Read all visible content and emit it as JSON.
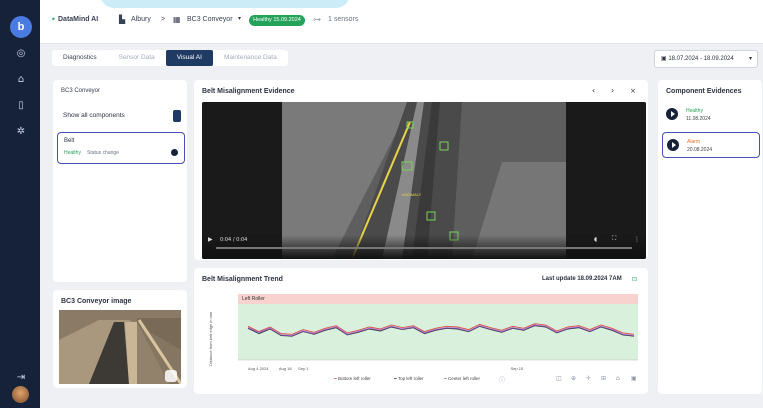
{
  "brand": {
    "name": "DataMind AI",
    "logo_letter": "b"
  },
  "breadcrumb": {
    "site": "Albury",
    "separator": ">",
    "asset": "BC3 Conveyor",
    "status": "Healthy 15.09.2024",
    "sensors": "1 sensors"
  },
  "tabs": [
    {
      "label": "Diagnostics"
    },
    {
      "label": "Sensor Data"
    },
    {
      "label": "Visual AI"
    },
    {
      "label": "Maintenance Data"
    }
  ],
  "date_range": "18.07.2024 - 18.09.2024",
  "components_panel": {
    "title": "BC3 Conveyor",
    "show_all": "Show all components",
    "belt": {
      "name": "Belt",
      "status": "Healthy",
      "note": "Status change"
    }
  },
  "image_panel": {
    "title": "BC3 Conveyor image"
  },
  "video_panel": {
    "title": "Belt Misalignment Evidence",
    "time": "0:04 / 0:04",
    "overlay_label": "ANOMALY"
  },
  "trend_panel": {
    "title": "Belt Misalignment Trend",
    "last_update": "Last update 18.09.2024 7AM",
    "legend": [
      "Bottom left roller",
      "Top left roller",
      "Center left roller"
    ]
  },
  "evidences_panel": {
    "title": "Component Evidences",
    "items": [
      {
        "label": "Healthy",
        "date": "11.08.2024",
        "color": "#25a35a"
      },
      {
        "label": "Alarm",
        "date": "20.08.2024",
        "color": "#e8722a"
      }
    ]
  },
  "colors": {
    "sidebar": "#16213a",
    "accent": "#1f3a63",
    "healthy": "#25a35a",
    "alarm": "#e8722a",
    "series_bottom": "#d94b4b",
    "series_top": "#2b3140",
    "series_center": "#a05fc7"
  },
  "chart_data": {
    "type": "line",
    "title": "Belt Misalignment Trend",
    "subtitle": "Left Roller",
    "xlabel": "",
    "ylabel": "Distance from belt edge in mm",
    "x_ticks": [
      "Aug 4 2024",
      "Aug 18",
      "Sep 1",
      "Sep 15"
    ],
    "ylim": [
      0,
      10
    ],
    "series": [
      {
        "name": "Bottom left roller",
        "values": [
          5.1,
          4.3,
          5.0,
          4.0,
          3.9,
          4.6,
          4.2,
          4.8,
          5.2,
          4.1,
          4.5,
          5.0,
          4.7,
          5.3,
          4.9,
          5.2,
          4.3,
          4.8,
          5.1,
          5.0,
          4.6,
          5.4,
          4.9,
          4.5,
          5.1,
          4.8,
          5.5,
          5.3,
          4.4,
          5.0,
          5.2,
          4.6,
          5.3,
          4.8,
          4.1,
          3.9
        ]
      },
      {
        "name": "Top left roller",
        "values": [
          4.8,
          4.0,
          4.7,
          3.7,
          3.6,
          4.3,
          3.9,
          4.5,
          4.9,
          3.8,
          4.2,
          4.7,
          4.4,
          5.0,
          4.6,
          4.9,
          4.0,
          4.5,
          4.8,
          4.7,
          4.3,
          5.1,
          4.6,
          4.2,
          4.8,
          4.5,
          5.2,
          5.0,
          4.1,
          4.7,
          4.9,
          4.3,
          5.0,
          4.5,
          3.8,
          3.6
        ]
      },
      {
        "name": "Center left roller",
        "values": [
          4.9,
          4.2,
          4.8,
          3.8,
          3.7,
          4.4,
          4.0,
          4.6,
          5.0,
          3.9,
          4.3,
          4.8,
          4.5,
          5.1,
          4.7,
          5.0,
          4.1,
          4.6,
          4.9,
          4.8,
          4.4,
          5.2,
          4.7,
          4.3,
          4.9,
          4.6,
          5.3,
          5.1,
          4.2,
          4.8,
          5.0,
          4.4,
          5.1,
          4.6,
          3.9,
          3.7
        ]
      }
    ],
    "bands": {
      "alarm_above": 8,
      "healthy_range": [
        2,
        8
      ]
    },
    "grid": false
  }
}
